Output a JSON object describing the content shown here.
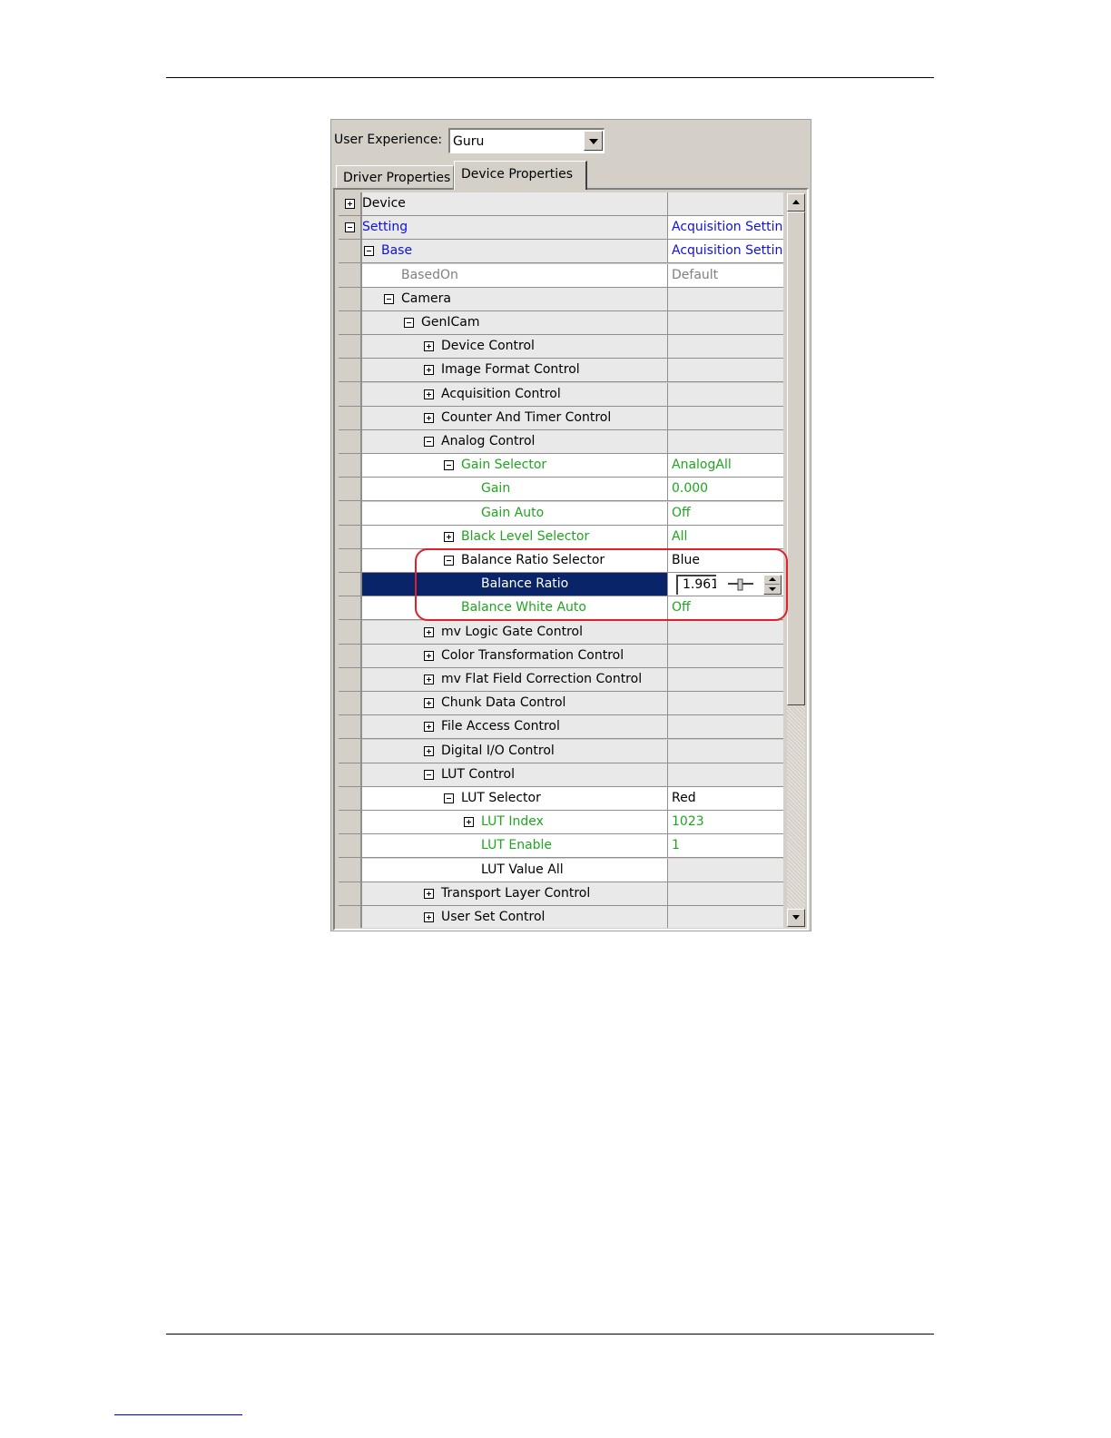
{
  "toolbar": {
    "user_experience_label": "User Experience:",
    "user_experience_value": "Guru"
  },
  "tabs": [
    {
      "label": "Driver Properties",
      "active": false
    },
    {
      "label": "Device Properties",
      "active": true
    }
  ],
  "tree": {
    "rows": [
      {
        "name": "Device",
        "value": "",
        "level": 0,
        "expander": "plus",
        "color": "black"
      },
      {
        "name": "Setting",
        "value": "Acquisition Setting",
        "level": 0,
        "expander": "minus",
        "color": "blue"
      },
      {
        "name": "Base",
        "value": "Acquisition Setting",
        "level": 1,
        "expander": "minus",
        "color": "blue"
      },
      {
        "name": "BasedOn",
        "value": "Default",
        "level": 2,
        "expander": "none",
        "color": "gray"
      },
      {
        "name": "Camera",
        "value": "",
        "level": 2,
        "expander": "minus",
        "color": "black"
      },
      {
        "name": "GenICam",
        "value": "",
        "level": 3,
        "expander": "minus",
        "color": "black"
      },
      {
        "name": "Device Control",
        "value": "",
        "level": 4,
        "expander": "plus",
        "color": "black"
      },
      {
        "name": "Image Format Control",
        "value": "",
        "level": 4,
        "expander": "plus",
        "color": "black"
      },
      {
        "name": "Acquisition Control",
        "value": "",
        "level": 4,
        "expander": "plus",
        "color": "black"
      },
      {
        "name": "Counter And Timer Control",
        "value": "",
        "level": 4,
        "expander": "plus",
        "color": "black"
      },
      {
        "name": "Analog Control",
        "value": "",
        "level": 4,
        "expander": "minus",
        "color": "black"
      },
      {
        "name": "Gain Selector",
        "value": "AnalogAll",
        "level": 5,
        "expander": "minus",
        "color": "green"
      },
      {
        "name": "Gain",
        "value": "0.000",
        "level": 6,
        "expander": "none",
        "color": "green"
      },
      {
        "name": "Gain Auto",
        "value": "Off",
        "level": 6,
        "expander": "none",
        "color": "green"
      },
      {
        "name": "Black Level Selector",
        "value": "All",
        "level": 5,
        "expander": "plus",
        "color": "green"
      },
      {
        "name": "Balance Ratio Selector",
        "value": "Blue",
        "level": 5,
        "expander": "minus",
        "color": "black"
      },
      {
        "name": "Balance Ratio",
        "value": "1.961",
        "level": 6,
        "expander": "none",
        "color": "black",
        "selected": true
      },
      {
        "name": "Balance White Auto",
        "value": "Off",
        "level": 5,
        "expander": "none",
        "color": "green"
      },
      {
        "name": "mv Logic Gate Control",
        "value": "",
        "level": 4,
        "expander": "plus",
        "color": "black"
      },
      {
        "name": "Color Transformation Control",
        "value": "",
        "level": 4,
        "expander": "plus",
        "color": "black"
      },
      {
        "name": "mv Flat Field Correction Control",
        "value": "",
        "level": 4,
        "expander": "plus",
        "color": "black"
      },
      {
        "name": "Chunk Data Control",
        "value": "",
        "level": 4,
        "expander": "plus",
        "color": "black"
      },
      {
        "name": "File Access Control",
        "value": "",
        "level": 4,
        "expander": "plus",
        "color": "black"
      },
      {
        "name": "Digital I/O Control",
        "value": "",
        "level": 4,
        "expander": "plus",
        "color": "black"
      },
      {
        "name": "LUT Control",
        "value": "",
        "level": 4,
        "expander": "minus",
        "color": "black"
      },
      {
        "name": "LUT Selector",
        "value": "Red",
        "level": 5,
        "expander": "minus",
        "color": "black"
      },
      {
        "name": "LUT Index",
        "value": "1023",
        "level": 6,
        "expander": "plus",
        "color": "green"
      },
      {
        "name": "LUT Enable",
        "value": "1",
        "level": 6,
        "expander": "none",
        "color": "green"
      },
      {
        "name": "LUT Value All",
        "value": "",
        "level": 6,
        "expander": "none",
        "color": "black"
      },
      {
        "name": "Transport Layer Control",
        "value": "",
        "level": 4,
        "expander": "plus",
        "color": "black"
      },
      {
        "name": "User Set Control",
        "value": "",
        "level": 4,
        "expander": "plus",
        "color": "black"
      }
    ]
  },
  "colors": {
    "selection": "#0a246a",
    "highlight_box": "#e0202a",
    "blue_text": "#1010e0",
    "green_text": "#1fa51f"
  },
  "icons": {
    "expand": "plus-box-icon",
    "collapse": "minus-box-icon",
    "slider": "slider-icon"
  }
}
